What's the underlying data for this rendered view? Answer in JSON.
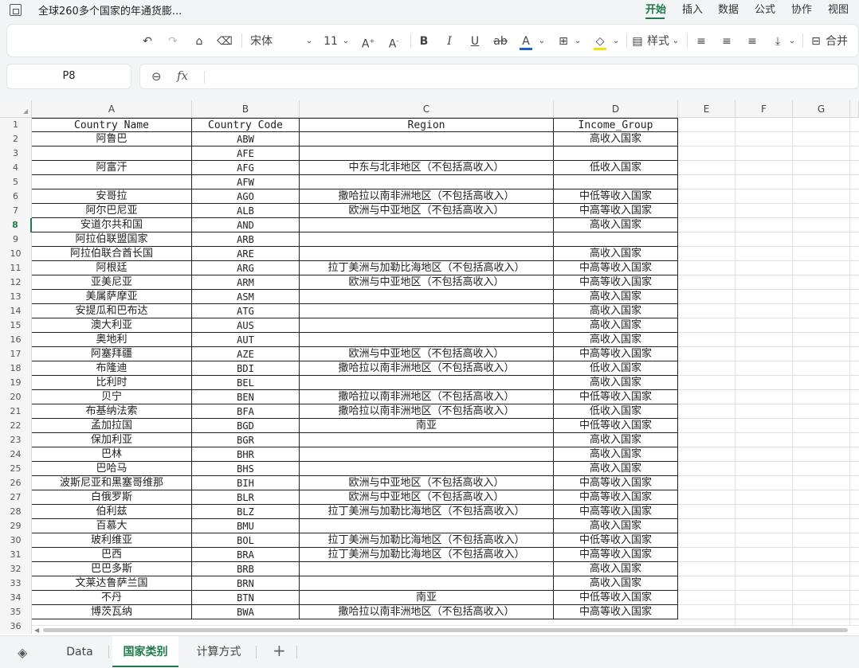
{
  "app": {
    "title": "全球260多个国家的年通货膨..."
  },
  "menu": [
    "开始",
    "插入",
    "数据",
    "公式",
    "协作",
    "视图"
  ],
  "toolbar": {
    "font_name": "宋体",
    "font_size": "11",
    "style_label": "样式",
    "merge_label": "合并",
    "accent_color": "#1f7a4a",
    "font_color": "#1a5fd6",
    "highlight_color": "#f5e000"
  },
  "formula_bar": {
    "cell_ref": "P8",
    "fx": "fx",
    "content": ""
  },
  "columns": [
    "A",
    "B",
    "C",
    "D",
    "E",
    "F",
    "G"
  ],
  "header_row": {
    "row": "1",
    "a": "Country Name",
    "b": "Country Code",
    "c": "Region",
    "d": "Income_Group"
  },
  "rows": [
    {
      "n": "2",
      "a": "阿鲁巴",
      "b": "ABW",
      "c": "",
      "d": "高收入国家"
    },
    {
      "n": "3",
      "a": "",
      "b": "AFE",
      "c": "",
      "d": ""
    },
    {
      "n": "4",
      "a": "阿富汗",
      "b": "AFG",
      "c": "中东与北非地区（不包括高收入）",
      "d": "低收入国家"
    },
    {
      "n": "5",
      "a": "",
      "b": "AFW",
      "c": "",
      "d": ""
    },
    {
      "n": "6",
      "a": "安哥拉",
      "b": "AGO",
      "c": "撒哈拉以南非洲地区（不包括高收入）",
      "d": "中低等收入国家"
    },
    {
      "n": "7",
      "a": "阿尔巴尼亚",
      "b": "ALB",
      "c": "欧洲与中亚地区（不包括高收入）",
      "d": "中高等收入国家"
    },
    {
      "n": "8",
      "a": "安道尔共和国",
      "b": "AND",
      "c": "",
      "d": "高收入国家"
    },
    {
      "n": "9",
      "a": "阿拉伯联盟国家",
      "b": "ARB",
      "c": "",
      "d": ""
    },
    {
      "n": "10",
      "a": "阿拉伯联合酋长国",
      "b": "ARE",
      "c": "",
      "d": "高收入国家"
    },
    {
      "n": "11",
      "a": "阿根廷",
      "b": "ARG",
      "c": "拉丁美洲与加勒比海地区（不包括高收入）",
      "d": "中高等收入国家"
    },
    {
      "n": "12",
      "a": "亚美尼亚",
      "b": "ARM",
      "c": "欧洲与中亚地区（不包括高收入）",
      "d": "中高等收入国家"
    },
    {
      "n": "13",
      "a": "美属萨摩亚",
      "b": "ASM",
      "c": "",
      "d": "高收入国家"
    },
    {
      "n": "14",
      "a": "安提瓜和巴布达",
      "b": "ATG",
      "c": "",
      "d": "高收入国家"
    },
    {
      "n": "15",
      "a": "澳大利亚",
      "b": "AUS",
      "c": "",
      "d": "高收入国家"
    },
    {
      "n": "16",
      "a": "奥地利",
      "b": "AUT",
      "c": "",
      "d": "高收入国家"
    },
    {
      "n": "17",
      "a": "阿塞拜疆",
      "b": "AZE",
      "c": "欧洲与中亚地区（不包括高收入）",
      "d": "中高等收入国家"
    },
    {
      "n": "18",
      "a": "布隆迪",
      "b": "BDI",
      "c": "撒哈拉以南非洲地区（不包括高收入）",
      "d": "低收入国家"
    },
    {
      "n": "19",
      "a": "比利时",
      "b": "BEL",
      "c": "",
      "d": "高收入国家"
    },
    {
      "n": "20",
      "a": "贝宁",
      "b": "BEN",
      "c": "撒哈拉以南非洲地区（不包括高收入）",
      "d": "中低等收入国家"
    },
    {
      "n": "21",
      "a": "布基纳法索",
      "b": "BFA",
      "c": "撒哈拉以南非洲地区（不包括高收入）",
      "d": "低收入国家"
    },
    {
      "n": "22",
      "a": "孟加拉国",
      "b": "BGD",
      "c": "南亚",
      "d": "中低等收入国家"
    },
    {
      "n": "23",
      "a": "保加利亚",
      "b": "BGR",
      "c": "",
      "d": "高收入国家"
    },
    {
      "n": "24",
      "a": "巴林",
      "b": "BHR",
      "c": "",
      "d": "高收入国家"
    },
    {
      "n": "25",
      "a": "巴哈马",
      "b": "BHS",
      "c": "",
      "d": "高收入国家"
    },
    {
      "n": "26",
      "a": "波斯尼亚和黑塞哥维那",
      "b": "BIH",
      "c": "欧洲与中亚地区（不包括高收入）",
      "d": "中高等收入国家"
    },
    {
      "n": "27",
      "a": "白俄罗斯",
      "b": "BLR",
      "c": "欧洲与中亚地区（不包括高收入）",
      "d": "中高等收入国家"
    },
    {
      "n": "28",
      "a": "伯利兹",
      "b": "BLZ",
      "c": "拉丁美洲与加勒比海地区（不包括高收入）",
      "d": "中高等收入国家"
    },
    {
      "n": "29",
      "a": "百慕大",
      "b": "BMU",
      "c": "",
      "d": "高收入国家"
    },
    {
      "n": "30",
      "a": "玻利维亚",
      "b": "BOL",
      "c": "拉丁美洲与加勒比海地区（不包括高收入）",
      "d": "中低等收入国家"
    },
    {
      "n": "31",
      "a": "巴西",
      "b": "BRA",
      "c": "拉丁美洲与加勒比海地区（不包括高收入）",
      "d": "中高等收入国家"
    },
    {
      "n": "32",
      "a": "巴巴多斯",
      "b": "BRB",
      "c": "",
      "d": "高收入国家"
    },
    {
      "n": "33",
      "a": "文莱达鲁萨兰国",
      "b": "BRN",
      "c": "",
      "d": "高收入国家"
    },
    {
      "n": "34",
      "a": "不丹",
      "b": "BTN",
      "c": "南亚",
      "d": "中低等收入国家"
    },
    {
      "n": "35",
      "a": "博茨瓦纳",
      "b": "BWA",
      "c": "撒哈拉以南非洲地区（不包括高收入）",
      "d": "中高等收入国家"
    }
  ],
  "partial_row": {
    "n": "36"
  },
  "sheet_tabs": [
    "Data",
    "国家类别",
    "计算方式"
  ],
  "active_tab": "国家类别"
}
